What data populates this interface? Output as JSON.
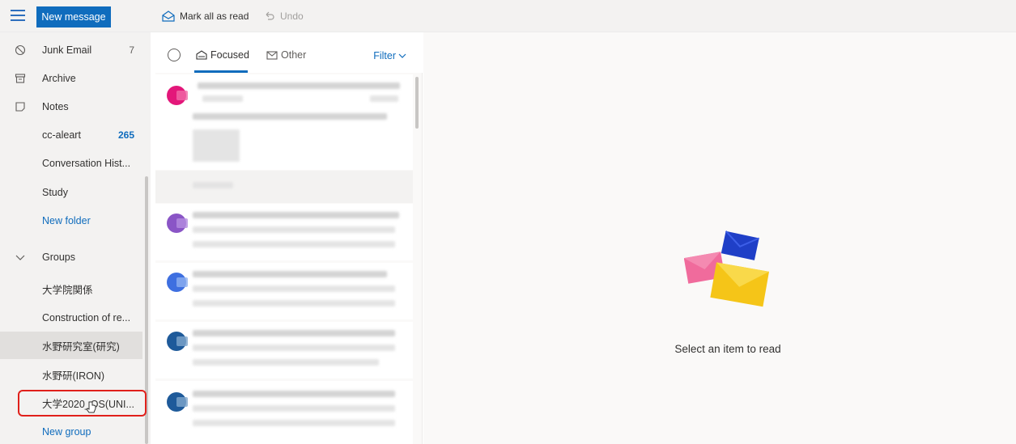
{
  "toolbar": {
    "new_message": "New message",
    "mark_all_read": "Mark all as read",
    "undo": "Undo"
  },
  "sidebar": {
    "items": [
      {
        "label": "Junk Email",
        "count": "7"
      },
      {
        "label": "Archive",
        "count": ""
      },
      {
        "label": "Notes",
        "count": ""
      },
      {
        "label": "cc-aleart",
        "count": "265"
      },
      {
        "label": "Conversation Hist...",
        "count": ""
      },
      {
        "label": "Study",
        "count": ""
      },
      {
        "label": "New folder",
        "count": ""
      }
    ],
    "groups_header": "Groups",
    "groups": [
      {
        "label": "大学院関係"
      },
      {
        "label": "Construction of re..."
      },
      {
        "label": "水野研究室(研究)"
      },
      {
        "label": "水野研(IRON)"
      },
      {
        "label": "大学2020_OS(UNI..."
      },
      {
        "label": "New group"
      }
    ]
  },
  "message_list": {
    "tabs": [
      {
        "label": "Focused",
        "active": true
      },
      {
        "label": "Other",
        "active": false
      }
    ],
    "filter_label": "Filter"
  },
  "reading_pane": {
    "empty_text": "Select an item to read"
  },
  "colors": {
    "accent": "#0f6cbd",
    "highlight_border": "#e0201b",
    "avatar_pink": "#e3177a",
    "avatar_purple": "#8a55c6",
    "avatar_blue": "#3e6fe0",
    "avatar_darkblue": "#1e5a9a"
  },
  "icons": [
    "hamburger-icon",
    "envelope-open-icon",
    "undo-icon",
    "block-icon",
    "archive-icon",
    "notes-icon",
    "chevron-down-icon",
    "check-circle-icon",
    "focused-icon",
    "other-icon",
    "cursor-icon"
  ]
}
